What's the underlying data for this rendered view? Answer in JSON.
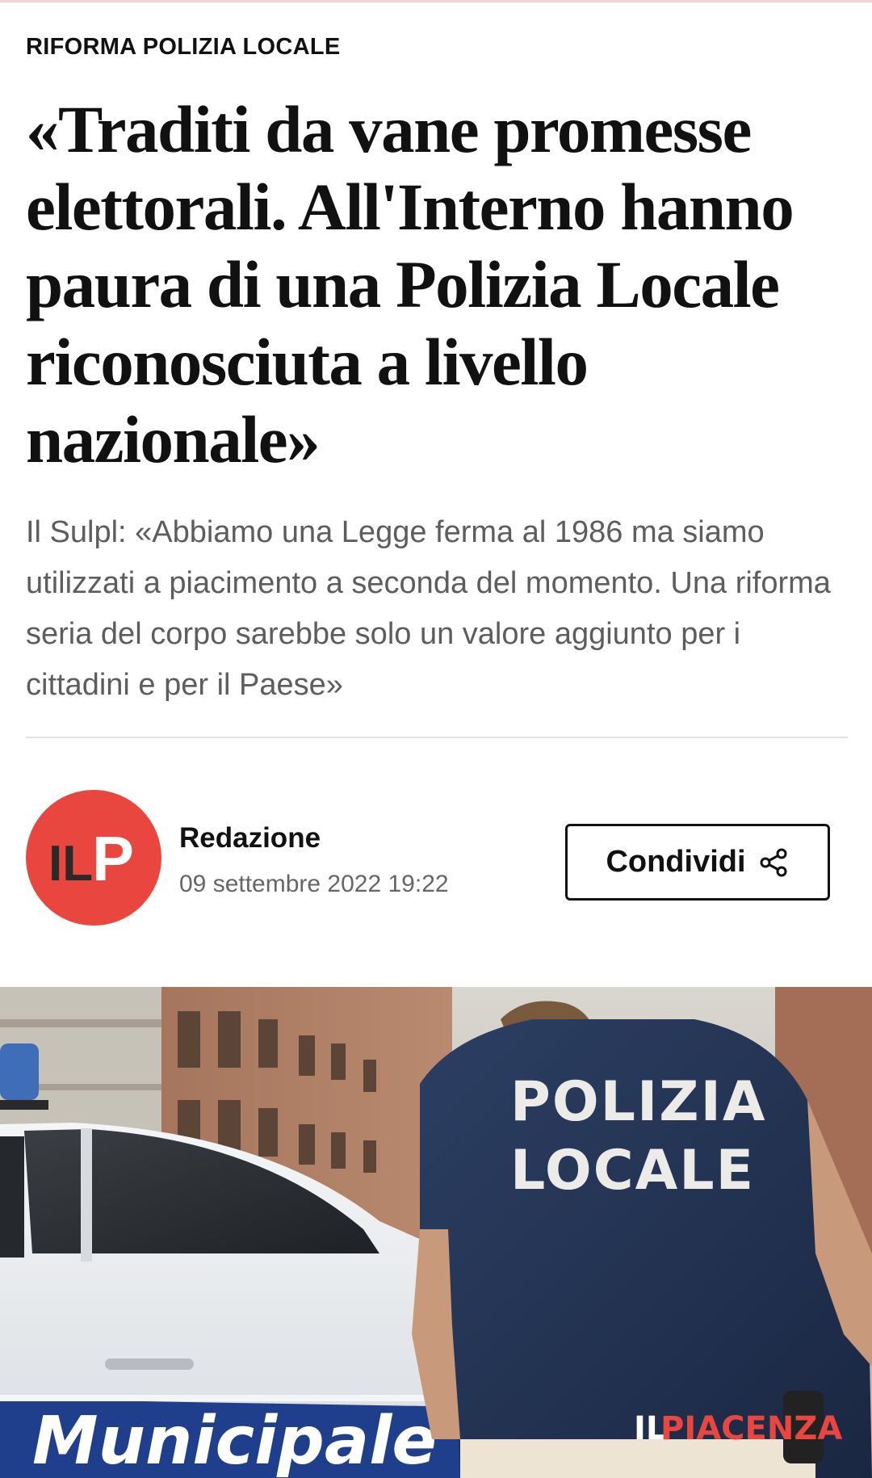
{
  "article": {
    "kicker": "RIFORMA POLIZIA LOCALE",
    "headline": "«Traditi da vane promesse elettorali. All'Interno hanno paura di una Polizia Locale riconosciuta a livello nazionale»",
    "summary": "Il Sulpl: «Abbiamo una Legge ferma al 1986 ma siamo utilizzati a piacimento a seconda del momento. Una riforma seria del corpo sarebbe solo un valore aggiunto per i cittadini e per il Paese»"
  },
  "author": {
    "avatar_initials_left": "IL",
    "avatar_initials_right": "P",
    "name": "Redazione",
    "date": "09 settembre 2022 19:22"
  },
  "share": {
    "label": "Condividi",
    "icon": "share-icon"
  },
  "photo": {
    "shirt_line1": "POLIZIA",
    "shirt_line2": "LOCALE",
    "car_text": "Municipale",
    "watermark_left": "IL",
    "watermark_right": "PIACENZA"
  },
  "colors": {
    "brand_red": "#e8463e",
    "summary_gray": "#5d5d5d"
  }
}
